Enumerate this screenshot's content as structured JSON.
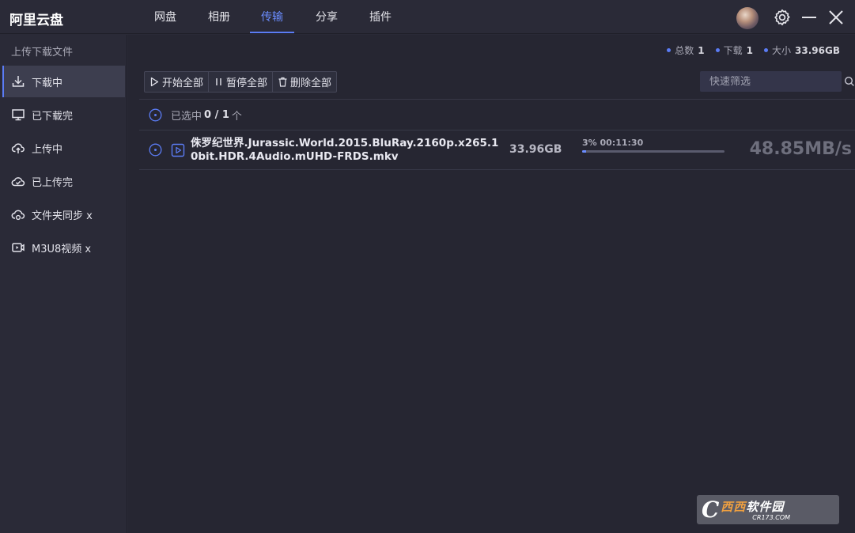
{
  "app": {
    "title": "阿里云盘"
  },
  "nav": {
    "tabs": [
      {
        "label": "网盘"
      },
      {
        "label": "相册"
      },
      {
        "label": "传输",
        "active": true
      },
      {
        "label": "分享"
      },
      {
        "label": "插件"
      }
    ],
    "accent_color": "#5b7cf5"
  },
  "sidebar": {
    "header": "上传下载文件",
    "items": [
      {
        "label": "下载中",
        "icon": "download-icon",
        "active": true
      },
      {
        "label": "已下载完",
        "icon": "monitor-icon"
      },
      {
        "label": "上传中",
        "icon": "cloud-upload-icon"
      },
      {
        "label": "已上传完",
        "icon": "cloud-check-icon"
      },
      {
        "label": "文件夹同步 x",
        "icon": "cloud-sync-icon"
      },
      {
        "label": "M3U8视频 x",
        "icon": "video-icon"
      }
    ]
  },
  "stats": [
    {
      "label": "总数",
      "value": "1"
    },
    {
      "label": "下载",
      "value": "1"
    },
    {
      "label": "大小",
      "value": "33.96GB"
    }
  ],
  "toolbar": {
    "start_all": "开始全部",
    "pause_all": "暂停全部",
    "delete_all": "删除全部"
  },
  "search": {
    "placeholder": "快速筛选"
  },
  "selection": {
    "prefix": "已选中",
    "count": "0 / 1",
    "suffix": "个"
  },
  "files": [
    {
      "name": "侏罗纪世界.Jurassic.World.2015.BluRay.2160p.x265.10bit.HDR.4Audio.mUHD-FRDS.mkv",
      "size": "33.96GB",
      "progress_label": "3% 00:11:30",
      "progress": 0.03,
      "speed": "48.85MB/s"
    }
  ],
  "watermark": {
    "main_a": "西西",
    "main_b": "软件园",
    "sub": "CR173.COM"
  }
}
